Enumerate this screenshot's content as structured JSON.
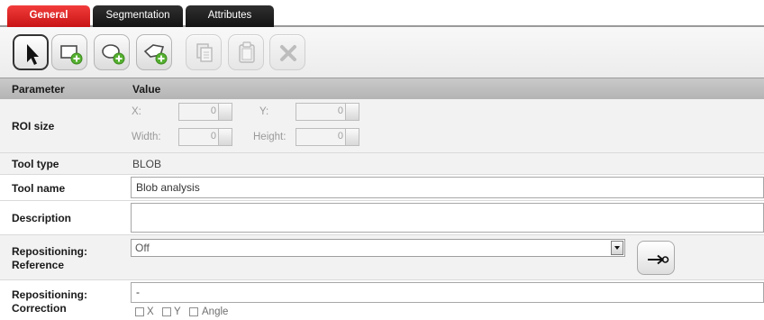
{
  "tabs": {
    "general": "General",
    "segmentation": "Segmentation",
    "attributes": "Attributes"
  },
  "toolbar": {
    "tools": [
      {
        "name": "select-pointer-icon",
        "state": "selected"
      },
      {
        "name": "add-rectangle-icon",
        "state": "enabled"
      },
      {
        "name": "add-ellipse-icon",
        "state": "enabled"
      },
      {
        "name": "add-polygon-icon",
        "state": "enabled"
      },
      {
        "name": "copy-icon",
        "state": "disabled"
      },
      {
        "name": "paste-icon",
        "state": "disabled"
      },
      {
        "name": "delete-icon",
        "state": "disabled"
      }
    ]
  },
  "header": {
    "parameter": "Parameter",
    "value": "Value"
  },
  "rows": {
    "roi_size": {
      "label": "ROI size",
      "x_label": "X:",
      "x_value": "0",
      "y_label": "Y:",
      "y_value": "0",
      "width_label": "Width:",
      "width_value": "0",
      "height_label": "Height:",
      "height_value": "0"
    },
    "tool_type": {
      "label": "Tool type",
      "value": "BLOB"
    },
    "tool_name": {
      "label": "Tool name",
      "value": "Blob analysis"
    },
    "description": {
      "label": "Description",
      "value": ""
    },
    "repositioning_reference": {
      "label_line1": "Repositioning:",
      "label_line2": "Reference",
      "value": "Off",
      "go_icon": "arrow-to-target-icon"
    },
    "repositioning_correction": {
      "label_line1": "Repositioning:",
      "label_line2": "Correction",
      "value": "-",
      "options": [
        "X",
        "Y",
        "Angle"
      ]
    }
  },
  "colors": {
    "active_tab": "#d81e1e",
    "inactive_tab": "#1f1f1f",
    "header_bg": "#bfbfbf",
    "add_icon_green": "#55b030"
  }
}
